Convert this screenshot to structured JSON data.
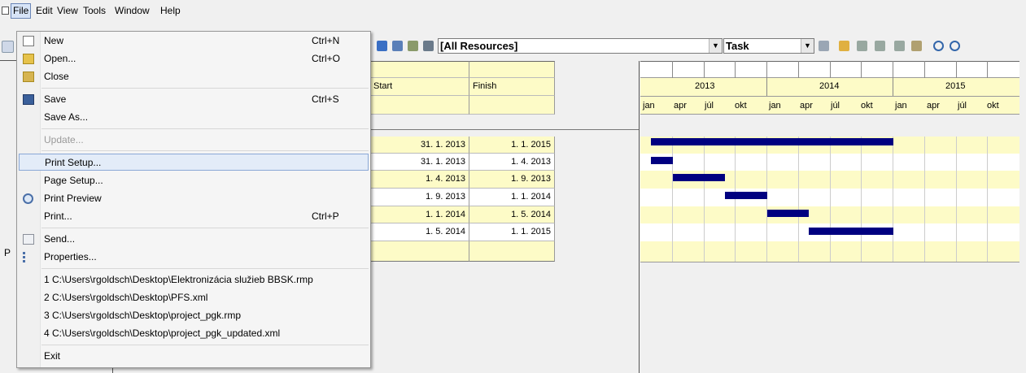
{
  "menubar": {
    "items": [
      "File",
      "Edit",
      "View",
      "Tools",
      "Window",
      "Help"
    ]
  },
  "toolbar": {
    "resources_combo": "[All Resources]",
    "task_combo": "Task"
  },
  "table": {
    "headers": [
      "Start",
      "Finish"
    ],
    "rows": [
      {
        "start": "31. 1. 2013",
        "finish": "1. 1. 2015"
      },
      {
        "start": "31. 1. 2013",
        "finish": "1. 4. 2013"
      },
      {
        "start": "1. 4. 2013",
        "finish": "1. 9. 2013"
      },
      {
        "start": "1. 9. 2013",
        "finish": "1. 1. 2014"
      },
      {
        "start": "1. 1. 2014",
        "finish": "1. 5. 2014"
      },
      {
        "start": "1. 5. 2014",
        "finish": "1. 1. 2015"
      }
    ]
  },
  "gantt": {
    "years": [
      "2013",
      "2014",
      "2015"
    ],
    "months": [
      "jan",
      "apr",
      "júl",
      "okt",
      "jan",
      "apr",
      "júl",
      "okt",
      "jan",
      "apr",
      "júl",
      "okt"
    ]
  },
  "left_letter": "P",
  "file_menu": {
    "items": [
      {
        "label": "New",
        "shortcut": "Ctrl+N",
        "icon": "new-document-icon"
      },
      {
        "label": "Open...",
        "shortcut": "Ctrl+O",
        "icon": "open-folder-icon"
      },
      {
        "label": "Close",
        "shortcut": "",
        "icon": "close-folder-icon"
      },
      {
        "label": "Save",
        "shortcut": "Ctrl+S",
        "icon": "floppy-disk-icon"
      },
      {
        "label": "Save As...",
        "shortcut": "",
        "icon": ""
      },
      {
        "label": "Update...",
        "shortcut": "",
        "icon": ""
      },
      {
        "label": "Print Setup...",
        "shortcut": "",
        "icon": ""
      },
      {
        "label": "Page Setup...",
        "shortcut": "",
        "icon": ""
      },
      {
        "label": "Print Preview",
        "shortcut": "",
        "icon": "magnifier-icon"
      },
      {
        "label": "Print...",
        "shortcut": "Ctrl+P",
        "icon": ""
      },
      {
        "label": "Send...",
        "shortcut": "",
        "icon": "mail-icon"
      },
      {
        "label": "Properties...",
        "shortcut": "",
        "icon": "properties-icon"
      },
      {
        "label": "1 C:\\Users\\rgoldsch\\Desktop\\Elektronizácia služieb BBSK.rmp",
        "shortcut": "",
        "icon": ""
      },
      {
        "label": "2 C:\\Users\\rgoldsch\\Desktop\\PFS.xml",
        "shortcut": "",
        "icon": ""
      },
      {
        "label": "3 C:\\Users\\rgoldsch\\Desktop\\project_pgk.rmp",
        "shortcut": "",
        "icon": ""
      },
      {
        "label": "4 C:\\Users\\rgoldsch\\Desktop\\project_pgk_updated.xml",
        "shortcut": "",
        "icon": ""
      },
      {
        "label": "Exit",
        "shortcut": "",
        "icon": ""
      }
    ]
  },
  "colors": {
    "menu_highlight": "#e3ecf8",
    "table_header": "#fdfbc7",
    "gantt_bar": "#000080"
  }
}
